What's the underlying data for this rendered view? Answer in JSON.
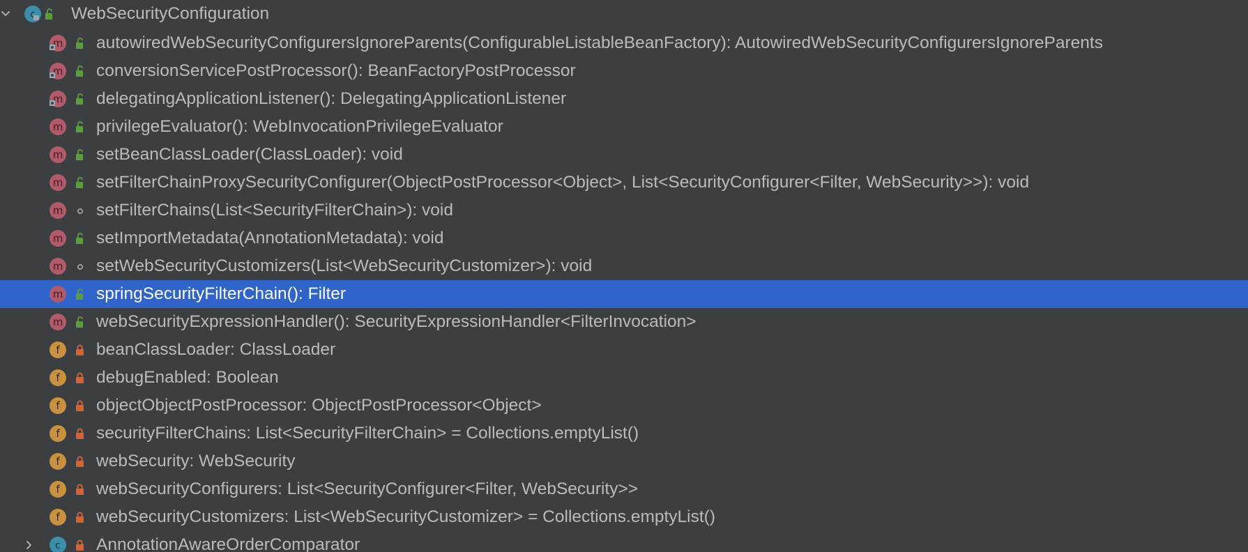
{
  "colors": {
    "background": "#3c3f41",
    "selection": "#2f65ca",
    "text": "#bbbbbb",
    "selected_text": "#ffffff",
    "method_badge": "#b35a6a",
    "field_badge": "#c9923c",
    "class_badge": "#3c8fa8",
    "public_lock": "#5a9e3a",
    "private_lock": "#d9622b"
  },
  "tree": {
    "root": {
      "label": "WebSecurityConfiguration",
      "kind_icon": "class-icon",
      "visibility_icon": "public-lock-icon",
      "expanded": true
    },
    "members": [
      {
        "label": "autowiredWebSecurityConfigurersIgnoreParents(ConfigurableListableBeanFactory): AutowiredWebSecurityConfigurersIgnoreParents",
        "kind": "m",
        "visibility": "public",
        "static": true
      },
      {
        "label": "conversionServicePostProcessor(): BeanFactoryPostProcessor",
        "kind": "m",
        "visibility": "public",
        "static": true
      },
      {
        "label": "delegatingApplicationListener(): DelegatingApplicationListener",
        "kind": "m",
        "visibility": "public",
        "static": true
      },
      {
        "label": "privilegeEvaluator(): WebInvocationPrivilegeEvaluator",
        "kind": "m",
        "visibility": "public",
        "static": false
      },
      {
        "label": "setBeanClassLoader(ClassLoader): void",
        "kind": "m",
        "visibility": "public",
        "static": false
      },
      {
        "label": "setFilterChainProxySecurityConfigurer(ObjectPostProcessor<Object>, List<SecurityConfigurer<Filter, WebSecurity>>): void",
        "kind": "m",
        "visibility": "public",
        "static": false
      },
      {
        "label": "setFilterChains(List<SecurityFilterChain>): void",
        "kind": "m",
        "visibility": "package",
        "static": false
      },
      {
        "label": "setImportMetadata(AnnotationMetadata): void",
        "kind": "m",
        "visibility": "public",
        "static": false
      },
      {
        "label": "setWebSecurityCustomizers(List<WebSecurityCustomizer>): void",
        "kind": "m",
        "visibility": "package",
        "static": false
      },
      {
        "label": "springSecurityFilterChain(): Filter",
        "kind": "m",
        "visibility": "public",
        "static": false,
        "selected": true
      },
      {
        "label": "webSecurityExpressionHandler(): SecurityExpressionHandler<FilterInvocation>",
        "kind": "m",
        "visibility": "public",
        "static": false
      },
      {
        "label": "beanClassLoader: ClassLoader",
        "kind": "f",
        "visibility": "private",
        "static": false
      },
      {
        "label": "debugEnabled: Boolean",
        "kind": "f",
        "visibility": "private",
        "static": false
      },
      {
        "label": "objectObjectPostProcessor: ObjectPostProcessor<Object>",
        "kind": "f",
        "visibility": "private",
        "static": false
      },
      {
        "label": "securityFilterChains: List<SecurityFilterChain> = Collections.emptyList()",
        "kind": "f",
        "visibility": "private",
        "static": false
      },
      {
        "label": "webSecurity: WebSecurity",
        "kind": "f",
        "visibility": "private",
        "static": false
      },
      {
        "label": "webSecurityConfigurers: List<SecurityConfigurer<Filter, WebSecurity>>",
        "kind": "f",
        "visibility": "private",
        "static": false
      },
      {
        "label": "webSecurityCustomizers: List<WebSecurityCustomizer> = Collections.emptyList()",
        "kind": "f",
        "visibility": "private",
        "static": false
      }
    ],
    "inner_class": {
      "label": "AnnotationAwareOrderComparator",
      "kind_icon": "class-icon",
      "visibility_icon": "private-lock-icon",
      "expanded": false
    }
  }
}
